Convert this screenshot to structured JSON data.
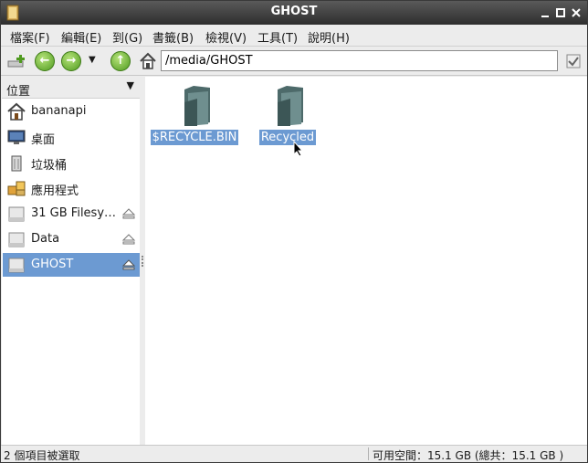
{
  "window": {
    "title": "GHOST"
  },
  "menu": [
    "檔案(F)",
    "編輯(E)",
    "到(G)",
    "書籤(B)",
    "檢視(V)",
    "工具(T)",
    "說明(H)"
  ],
  "toolbar": {
    "path_value": "/media/GHOST"
  },
  "sidepane": {
    "header": "位置",
    "items": [
      {
        "label": "bananapi",
        "icon": "home-icon"
      },
      {
        "label": "桌面",
        "icon": "desktop-icon"
      },
      {
        "label": "垃圾桶",
        "icon": "trash-icon"
      },
      {
        "label": "應用程式",
        "icon": "applications-icon"
      },
      {
        "label": "31 GB Filesy…",
        "icon": "drive-icon"
      },
      {
        "label": "Data",
        "icon": "drive-icon"
      },
      {
        "label": "GHOST",
        "icon": "drive-icon"
      }
    ]
  },
  "files": [
    {
      "name": "$RECYCLE.BIN",
      "icon": "folder-icon"
    },
    {
      "name": "Recycled",
      "icon": "folder-icon"
    }
  ],
  "status": {
    "selection": "2 個項目被選取",
    "free_space": "可用空間：15.1 GB (總共：15.1 GB )"
  }
}
